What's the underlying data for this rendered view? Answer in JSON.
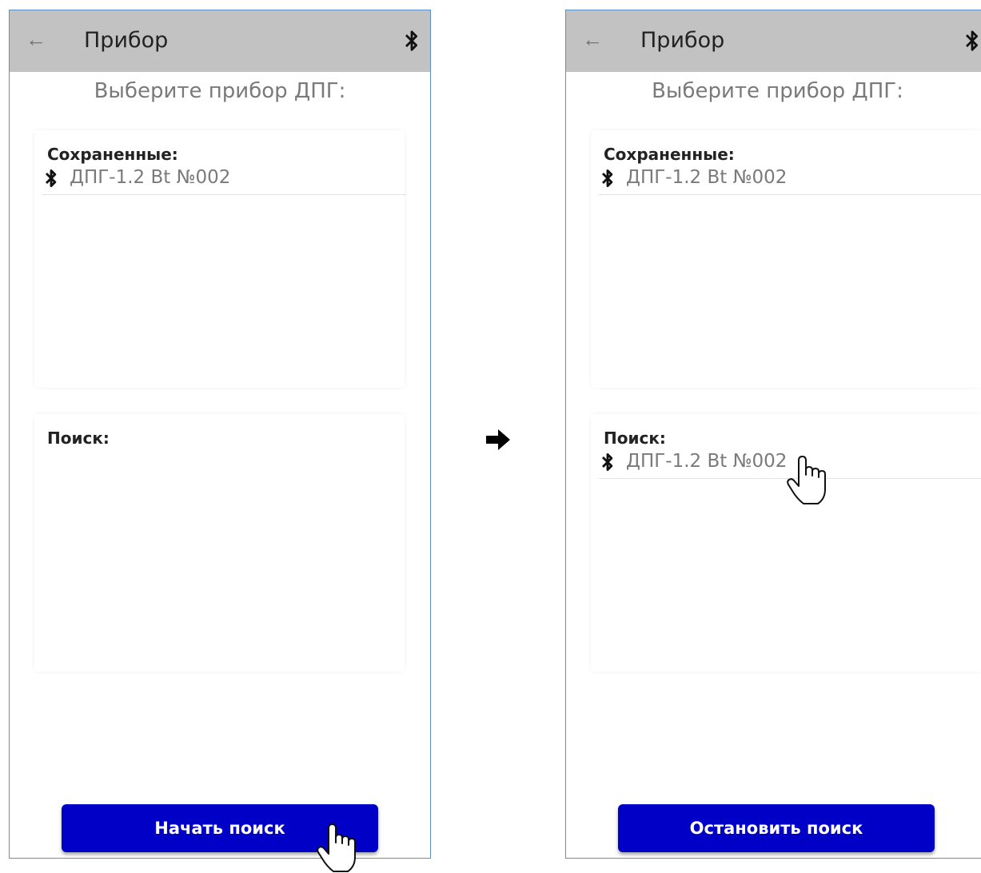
{
  "screens": [
    {
      "appbar": {
        "back_icon": "arrow-left-icon",
        "title": "Прибор",
        "status_icon": "bluetooth-icon"
      },
      "heading": "Выберите прибор ДПГ:",
      "saved": {
        "label": "Сохраненные:",
        "devices": [
          {
            "icon": "bluetooth-icon",
            "name": "ДПГ-1.2 Bt №002"
          }
        ]
      },
      "search": {
        "label": "Поиск:",
        "devices": []
      },
      "button_label": "Начать поиск"
    },
    {
      "appbar": {
        "back_icon": "arrow-left-icon",
        "title": "Прибор",
        "status_icon": "bluetooth-icon"
      },
      "heading": "Выберите прибор ДПГ:",
      "saved": {
        "label": "Сохраненные:",
        "devices": [
          {
            "icon": "bluetooth-icon",
            "name": "ДПГ-1.2 Bt №002"
          }
        ]
      },
      "search": {
        "label": "Поиск:",
        "devices": [
          {
            "icon": "bluetooth-icon",
            "name": "ДПГ-1.2 Bt №002"
          }
        ]
      },
      "button_label": "Остановить поиск"
    }
  ],
  "transition_icon": "arrow-right-icon",
  "pointer_icon": "hand-pointer-icon",
  "colors": {
    "appbar": "#c2c2c2",
    "button": "#0000c6",
    "frame": "#5b8fc9"
  }
}
